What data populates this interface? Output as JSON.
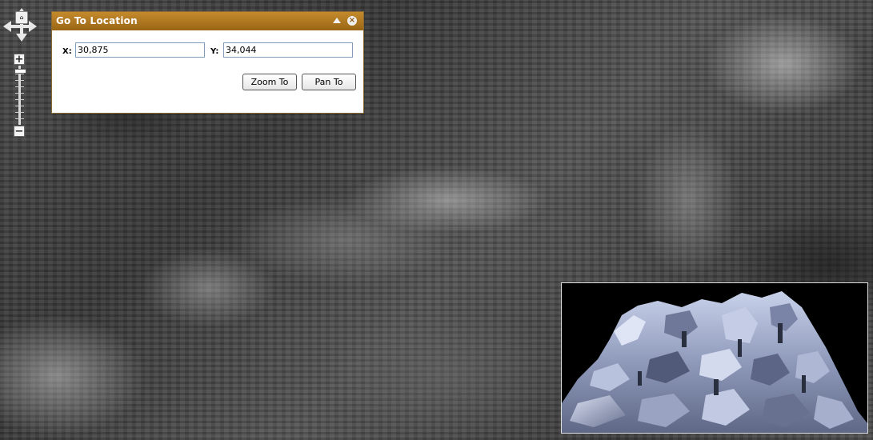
{
  "dialog": {
    "title": "Go To Location",
    "x_label": "X:",
    "y_label": "Y:",
    "x_value": "30,875",
    "y_value": "34,044",
    "zoom_to_label": "Zoom To",
    "pan_to_label": "Pan To"
  },
  "controls": {
    "zoom_in_symbol": "+",
    "zoom_out_symbol": "−",
    "full_extent_symbol": "⌂",
    "close_symbol": "×",
    "zoom_level": 0.05,
    "icons": {
      "pan_up": "arrow-up-icon",
      "pan_down": "arrow-down-icon",
      "pan_left": "arrow-left-icon",
      "pan_right": "arrow-right-icon",
      "full_extent": "home-icon",
      "collapse": "collapse-icon",
      "close": "close-icon"
    }
  },
  "colors": {
    "title_bar": "#b07a22",
    "terrain_3d": "#9aa6c4",
    "map_base": "#444444"
  }
}
